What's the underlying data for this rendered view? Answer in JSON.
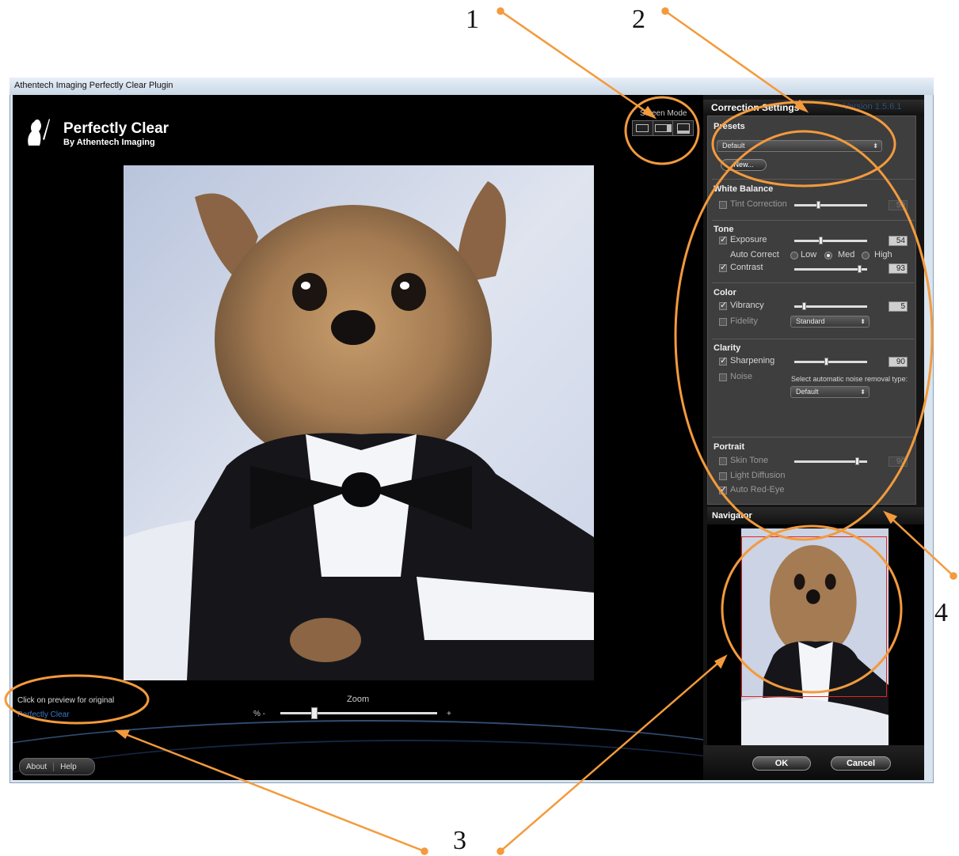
{
  "callouts": [
    "1",
    "2",
    "3",
    "4"
  ],
  "window": {
    "title": "Athentech Imaging Perfectly Clear Plugin"
  },
  "branding": {
    "title": "Perfectly Clear",
    "subtitle": "By Athentech Imaging"
  },
  "screen_mode": {
    "label": "Screen Mode",
    "buttons": [
      "single-view-icon",
      "split-view-icon",
      "split-horizontal-icon"
    ]
  },
  "preview": {
    "hint": "Click on preview for original",
    "brand_link": "Perfectly Clear"
  },
  "zoom": {
    "label": "Zoom",
    "minus": "% -",
    "plus": "+",
    "level": 0.2
  },
  "bottom_buttons": [
    "About",
    "Help"
  ],
  "settings": {
    "header": "Correction Settings",
    "version": "Version 1.5.6.1",
    "presets": {
      "title": "Presets",
      "selected": "Default",
      "new_button": "New..."
    },
    "white_balance": {
      "title": "White Balance",
      "tint_label": "Tint Correction",
      "tint_checked": false,
      "tint_value": "50"
    },
    "tone": {
      "title": "Tone",
      "exposure_label": "Exposure",
      "exposure_checked": true,
      "exposure_value": "54",
      "auto_correct_label": "Auto Correct",
      "low": "Low",
      "med": "Med",
      "high": "High",
      "auto_selected": "Med",
      "contrast_label": "Contrast",
      "contrast_checked": true,
      "contrast_value": "93"
    },
    "color": {
      "title": "Color",
      "vibrancy_label": "Vibrancy",
      "vibrancy_checked": true,
      "vibrancy_value": "5",
      "fidelity_label": "Fidelity",
      "fidelity_checked": false,
      "fidelity_option": "Standard"
    },
    "clarity": {
      "title": "Clarity",
      "sharpening_label": "Sharpening",
      "sharpening_checked": true,
      "sharpening_value": "90",
      "noise_label": "Noise",
      "noise_checked": false,
      "noise_hint": "Select automatic noise removal type:",
      "noise_option": "Default"
    },
    "portrait": {
      "title": "Portrait",
      "skin_label": "Skin Tone",
      "skin_checked": false,
      "skin_value": "90",
      "diffusion_label": "Light Diffusion",
      "diffusion_checked": false,
      "redeye_label": "Auto Red-Eye",
      "redeye_checked": true
    }
  },
  "navigator": {
    "title": "Navigator"
  },
  "actions": {
    "ok": "OK",
    "cancel": "Cancel"
  },
  "colors": {
    "annotation": "#f39a3c",
    "accent_link": "#3a78c8",
    "nav_frame": "#e0281e"
  }
}
